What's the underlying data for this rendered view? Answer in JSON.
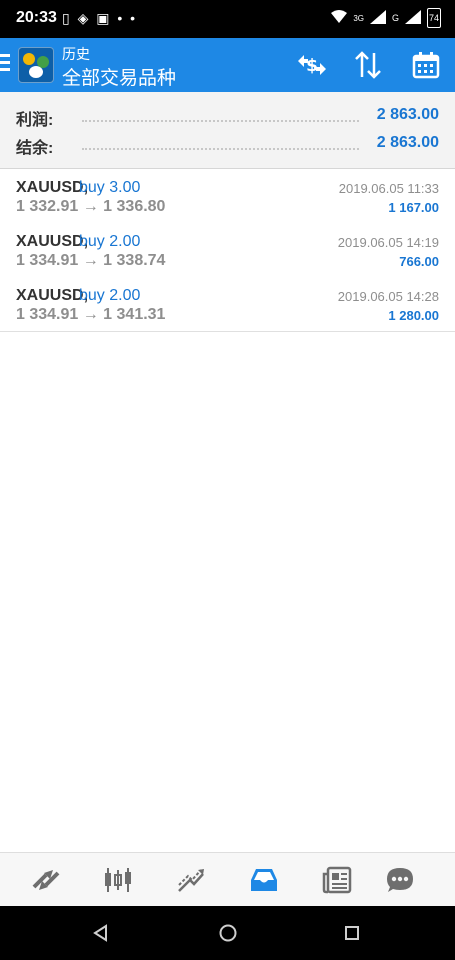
{
  "status_bar": {
    "time": "20:33",
    "left_icons": "▯ ◈ ▣ • •",
    "network_label": "3G",
    "signal_label": "G",
    "battery": "74"
  },
  "app_bar": {
    "subtitle": "历史",
    "title": "全部交易品种",
    "color": "#1e88e5"
  },
  "summary": {
    "profit_label": "利润:",
    "profit_value": "2 863.00",
    "balance_label": "结余:",
    "balance_value": "2 863.00"
  },
  "trades": [
    {
      "symbol": "XAUUSD,",
      "side": "buy 3.00",
      "prices": "1 332.91 → 1 336.80",
      "time": "2019.06.05 11:33",
      "profit": "1 167.00"
    },
    {
      "symbol": "XAUUSD,",
      "side": "buy 2.00",
      "prices": "1 334.91 → 1 338.74",
      "time": "2019.06.05 14:19",
      "profit": "766.00"
    },
    {
      "symbol": "XAUUSD,",
      "side": "buy 2.00",
      "prices": "1 334.91 → 1 341.31",
      "time": "2019.06.05 14:28",
      "profit": "1 280.00"
    }
  ],
  "bottom_nav": [
    "quotes-icon",
    "chart-icon",
    "trade-icon",
    "history-icon",
    "news-icon",
    "chat-icon"
  ],
  "accent": "#1976d2"
}
